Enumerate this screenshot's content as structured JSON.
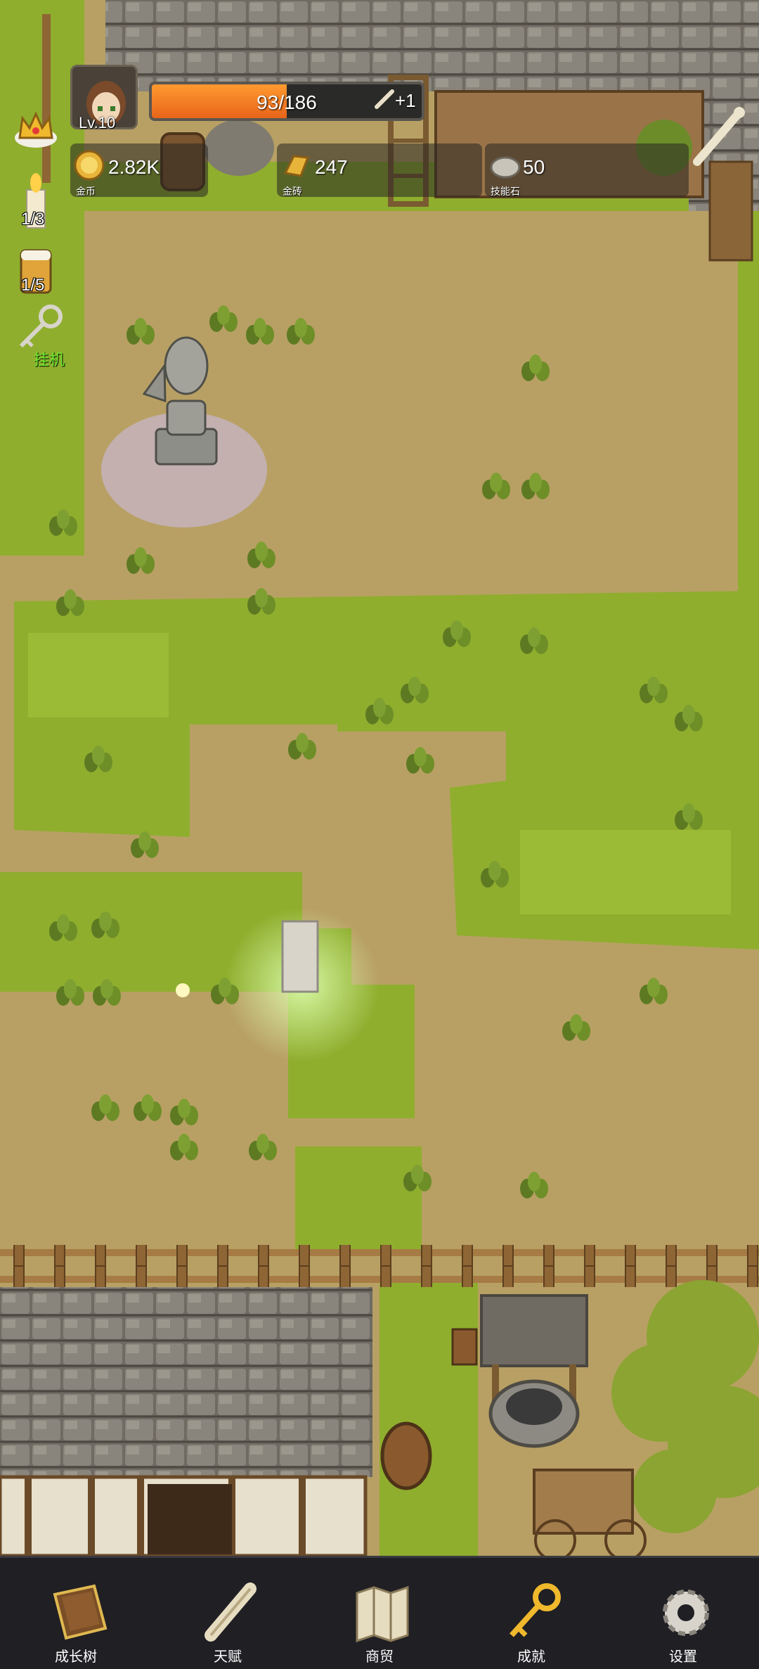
{
  "player": {
    "level": "Lv.10",
    "exp_text": "93/186",
    "exp_fraction": 0.5,
    "exp_bonus": "+1"
  },
  "resources": [
    {
      "icon": "gold-coin-icon",
      "value": "2.82K",
      "label": "金币"
    },
    {
      "icon": "gold-brick-icon",
      "value": "247",
      "label": "金砖"
    },
    {
      "icon": "skill-stone-icon",
      "value": "50",
      "label": "技能石"
    }
  ],
  "side": {
    "candle_count": "1/3",
    "beer_count": "1/5",
    "auto_label": "挂机"
  },
  "nav": [
    {
      "icon": "growth-book-icon",
      "label": "成长树"
    },
    {
      "icon": "talent-scroll-icon",
      "label": "天赋"
    },
    {
      "icon": "trade-map-icon",
      "label": "商贸"
    },
    {
      "icon": "achievement-key-icon",
      "label": "成就"
    },
    {
      "icon": "settings-gear-icon",
      "label": "设置"
    }
  ],
  "colors": {
    "dirt": "#b8a064",
    "grass": "#8fae2e",
    "exp_fill": "#f07a22",
    "nav_bg": "#1f1f24",
    "auto_label": "#6eea2e"
  }
}
